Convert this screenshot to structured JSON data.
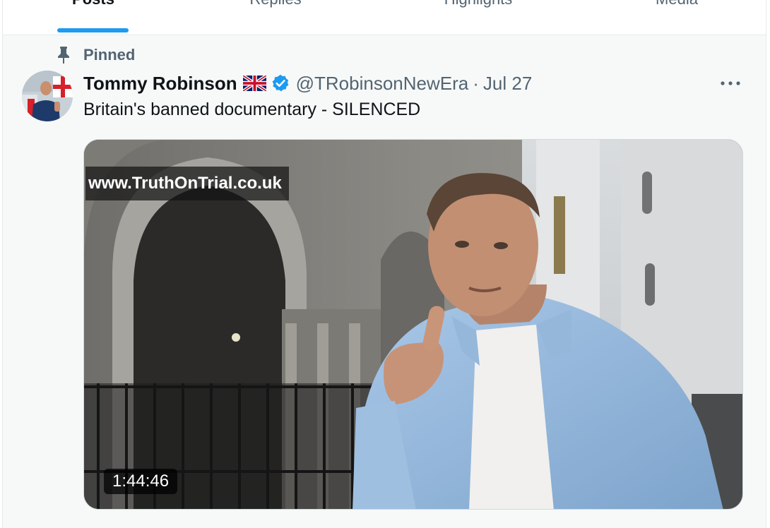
{
  "tabs": [
    {
      "label": "Posts",
      "active": true
    },
    {
      "label": "Replies",
      "active": false
    },
    {
      "label": "Highlights",
      "active": false
    },
    {
      "label": "Media",
      "active": false
    }
  ],
  "pinned": {
    "label": "Pinned",
    "icon": "pin-icon"
  },
  "tweet": {
    "author": {
      "display_name": "Tommy Robinson",
      "flag_icon": "uk-flag-icon",
      "verified_icon": "verified-badge-icon",
      "handle": "@TRobinsonNewEra"
    },
    "separator": "·",
    "date": "Jul 27",
    "more_icon": "more-options-icon",
    "text": "Britain's banned documentary - SILENCED",
    "media": {
      "watermark": "www.TruthOnTrial.co.uk",
      "duration": "1:44:46"
    }
  },
  "colors": {
    "accent": "#1d9bf0",
    "secondary_text": "#536471",
    "primary_text": "#0f1419"
  }
}
